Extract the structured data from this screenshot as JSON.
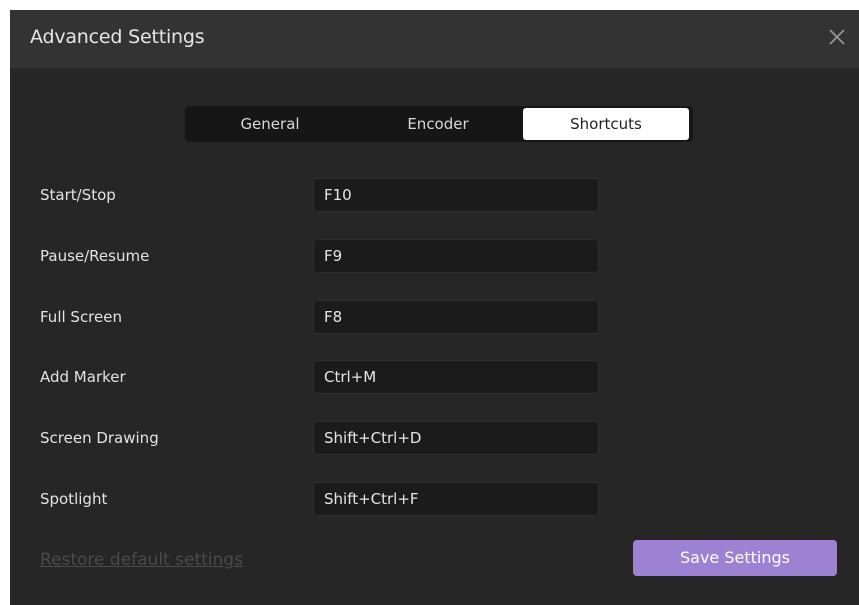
{
  "window": {
    "title": "Advanced Settings",
    "close_icon": "close-icon"
  },
  "tabs": [
    {
      "label": "General",
      "active": false
    },
    {
      "label": "Encoder",
      "active": false
    },
    {
      "label": "Shortcuts",
      "active": true
    }
  ],
  "shortcuts": [
    {
      "label": "Start/Stop",
      "value": "F10"
    },
    {
      "label": "Pause/Resume",
      "value": "F9"
    },
    {
      "label": "Full Screen",
      "value": "F8"
    },
    {
      "label": "Add Marker",
      "value": "Ctrl+M"
    },
    {
      "label": "Screen Drawing",
      "value": "Shift+Ctrl+D"
    },
    {
      "label": "Spotlight",
      "value": "Shift+Ctrl+F"
    }
  ],
  "footer": {
    "restore_label": "Restore default settings",
    "save_label": "Save Settings"
  },
  "colors": {
    "background": "#262626",
    "titlebar": "#333333",
    "accent": "#9d82d4",
    "active_tab": "#ffffff"
  }
}
